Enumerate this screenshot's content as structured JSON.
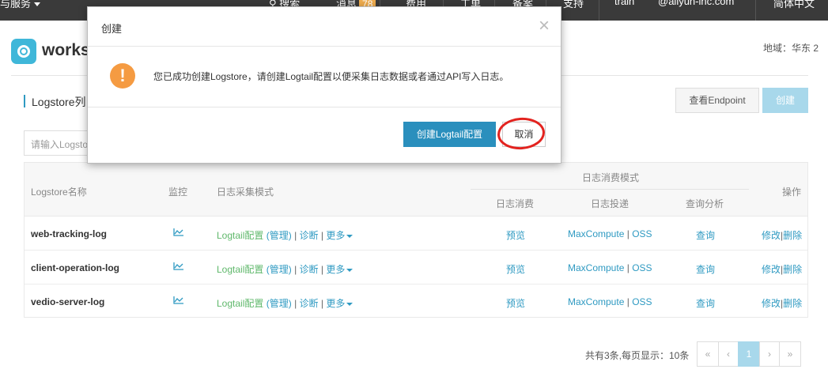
{
  "topbar": {
    "service": "与服务",
    "search": "搜索",
    "messages": "消息",
    "messages_count": "78",
    "billing": "费用",
    "workorder": "工单",
    "record": "备案",
    "support": "支持",
    "user": "train",
    "account": "@aliyun-inc.com",
    "language": "简体中文"
  },
  "header": {
    "project_title": "worksh",
    "region": "地域：华东 2"
  },
  "section": {
    "title": "Logstore列",
    "view_endpoint": "查看Endpoint",
    "create": "创建"
  },
  "search": {
    "placeholder": "请输入Logstore"
  },
  "table": {
    "headers": {
      "name": "Logstore名称",
      "monitor": "监控",
      "collect_mode": "日志采集模式",
      "consume_mode": "日志消费模式",
      "consume": "日志消费",
      "ship": "日志投递",
      "query": "查询分析",
      "ops": "操作"
    },
    "rows": [
      {
        "name": "web-tracking-log",
        "logtail": "Logtail配置",
        "manage": "(管理)",
        "diagnose": "诊断",
        "more": "更多",
        "preview": "预览",
        "maxcompute": "MaxCompute",
        "oss": "OSS",
        "query": "查询",
        "edit": "修改",
        "delete": "删除"
      },
      {
        "name": "client-operation-log",
        "logtail": "Logtail配置",
        "manage": "(管理)",
        "diagnose": "诊断",
        "more": "更多",
        "preview": "预览",
        "maxcompute": "MaxCompute",
        "oss": "OSS",
        "query": "查询",
        "edit": "修改",
        "delete": "删除"
      },
      {
        "name": "vedio-server-log",
        "logtail": "Logtail配置",
        "manage": "(管理)",
        "diagnose": "诊断",
        "more": "更多",
        "preview": "预览",
        "maxcompute": "MaxCompute",
        "oss": "OSS",
        "query": "查询",
        "edit": "修改",
        "delete": "删除"
      }
    ]
  },
  "pagination": {
    "summary": "共有3条,每页显示：10条",
    "first": "«",
    "prev": "‹",
    "current": "1",
    "next": "›",
    "last": "»"
  },
  "modal": {
    "title": "创建",
    "close": "×",
    "icon": "!",
    "message": "您已成功创建Logstore，请创建Logtail配置以便采集日志数据或者通过API写入日志。",
    "confirm": "创建Logtail配置",
    "cancel": "取消"
  },
  "colors": {
    "accent": "#2a8fbd",
    "warning": "#f59b42",
    "highlight_circle": "#e3231f"
  }
}
